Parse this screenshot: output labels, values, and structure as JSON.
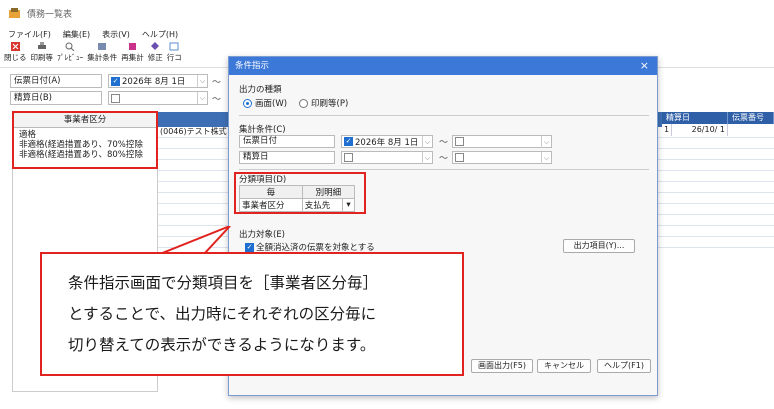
{
  "window": {
    "title": "債務一覧表"
  },
  "menu": [
    "ファイル(F)",
    "編集(E)",
    "表示(V)",
    "ヘルプ(H)"
  ],
  "toolbar": [
    {
      "label": "閉じる",
      "icon": "close-icon"
    },
    {
      "label": "印刷等",
      "icon": "print-icon"
    },
    {
      "label": "ﾌﾟﾚﾋﾞｭｰ",
      "icon": "preview-icon"
    },
    {
      "label": "集計条件",
      "icon": "filter-icon"
    },
    {
      "label": "再集計",
      "icon": "refresh-icon"
    },
    {
      "label": "修正",
      "icon": "edit-icon"
    },
    {
      "label": "行コ",
      "icon": "copy-icon"
    }
  ],
  "filters": {
    "row1": {
      "label": "伝票日付(A)",
      "date": "2026年  8月  1日",
      "checked": true
    },
    "row2": {
      "label": "精算日(B)",
      "checked": false
    },
    "tilde": "～"
  },
  "left_panel": {
    "header": "事業者区分",
    "items": [
      "適格",
      "非適格(経過措置あり、70%控除",
      "非適格(経過措置あり、80%控除"
    ]
  },
  "grid": {
    "first_row": "(0046)テスト株式",
    "right_headers": [
      "精算日",
      "伝票番号"
    ],
    "right_values": [
      "1",
      "26/10/ 1"
    ]
  },
  "dialog": {
    "title": "条件指示",
    "close": "×",
    "output_type": {
      "label": "出力の種類",
      "options": [
        "画面(W)",
        "印刷等(P)"
      ],
      "selected": 0
    },
    "conditions": {
      "label": "集計条件(C)",
      "rows": [
        {
          "label": "伝票日付",
          "date": "2026年  8月  1日",
          "checked": true
        },
        {
          "label": "精算日",
          "checked": false
        }
      ],
      "tilde": "～"
    },
    "classification": {
      "label": "分類項目(D)",
      "headers": [
        "毎",
        "別明細"
      ],
      "row": [
        "事業者区分",
        "支払先"
      ]
    },
    "output_target": {
      "label": "出力対象(E)",
      "checkbox": "全額消込済の伝票を対象とする",
      "checked": true,
      "items_button": "出力項目(Y)..."
    },
    "buttons": [
      "画面出力(F5)",
      "キャンセル",
      "ヘルプ(F1)"
    ]
  },
  "callout": {
    "lines": [
      "条件指示画面で分類項目を［事業者区分毎］",
      "とすることで、出力時にそれぞれの区分毎に",
      "切り替えての表示ができるようになります。"
    ]
  },
  "colors": {
    "accent": "#3c78d8",
    "highlight": "#e0231f"
  }
}
